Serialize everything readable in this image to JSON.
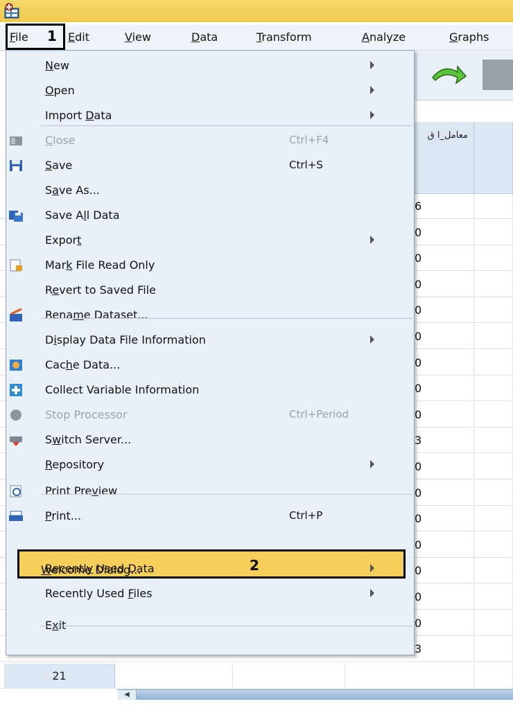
{
  "menubar": {
    "items": [
      {
        "pre": "",
        "u": "F",
        "post": "ile"
      },
      {
        "pre": "",
        "u": "E",
        "post": "dit"
      },
      {
        "pre": "",
        "u": "V",
        "post": "iew"
      },
      {
        "pre": "",
        "u": "D",
        "post": "ata"
      },
      {
        "pre": "",
        "u": "T",
        "post": "ransform"
      },
      {
        "pre": "",
        "u": "A",
        "post": "nalyze"
      },
      {
        "pre": "",
        "u": "G",
        "post": "raphs"
      }
    ],
    "callout_1": "1"
  },
  "grid": {
    "column_header": "معامل_ا ق",
    "fragments": [
      "6",
      "0",
      "0",
      "0",
      "0",
      "0",
      "0",
      "0",
      "0",
      "3",
      "0",
      "0",
      "0",
      "0",
      "0",
      "0",
      "0",
      "3"
    ],
    "row_label": "21"
  },
  "file_menu": {
    "items": [
      {
        "pre": "",
        "u": "N",
        "post": "ew",
        "shortcut": "",
        "submenu": true,
        "enabled": true
      },
      {
        "pre": "",
        "u": "O",
        "post": "pen",
        "shortcut": "",
        "submenu": true,
        "enabled": true
      },
      {
        "pre": "Import ",
        "u": "D",
        "post": "ata",
        "shortcut": "",
        "submenu": true,
        "enabled": true
      },
      {
        "pre": "",
        "u": "C",
        "post": "lose",
        "shortcut": "Ctrl+F4",
        "submenu": false,
        "enabled": false
      },
      {
        "pre": "",
        "u": "S",
        "post": "ave",
        "shortcut": "Ctrl+S",
        "submenu": false,
        "enabled": true
      },
      {
        "pre": "S",
        "u": "a",
        "post": "ve As...",
        "shortcut": "",
        "submenu": false,
        "enabled": true
      },
      {
        "pre": "Save A",
        "u": "l",
        "post": "l Data",
        "shortcut": "",
        "submenu": false,
        "enabled": true
      },
      {
        "pre": "Expor",
        "u": "t",
        "post": "",
        "shortcut": "",
        "submenu": true,
        "enabled": true
      },
      {
        "pre": "Mar",
        "u": "k",
        "post": " File Read Only",
        "shortcut": "",
        "submenu": false,
        "enabled": true
      },
      {
        "pre": "R",
        "u": "e",
        "post": "vert to Saved File",
        "shortcut": "",
        "submenu": false,
        "enabled": true
      },
      {
        "pre": "Rena",
        "u": "m",
        "post": "e Dataset...",
        "shortcut": "",
        "submenu": false,
        "enabled": true
      },
      {
        "pre": "D",
        "u": "i",
        "post": "splay Data File Information",
        "shortcut": "",
        "submenu": true,
        "enabled": true
      },
      {
        "pre": "Cac",
        "u": "h",
        "post": "e Data...",
        "shortcut": "",
        "submenu": false,
        "enabled": true
      },
      {
        "pre": "Collect Variable Information",
        "u": "",
        "post": "",
        "shortcut": "",
        "submenu": false,
        "enabled": true
      },
      {
        "pre": "Stop Processor",
        "u": "",
        "post": "",
        "shortcut": "Ctrl+Period",
        "submenu": false,
        "enabled": false
      },
      {
        "pre": "S",
        "u": "w",
        "post": "itch Server...",
        "shortcut": "",
        "submenu": false,
        "enabled": true
      },
      {
        "pre": "",
        "u": "R",
        "post": "epository",
        "shortcut": "",
        "submenu": true,
        "enabled": true
      },
      {
        "pre": "Print Pre",
        "u": "v",
        "post": "iew",
        "shortcut": "",
        "submenu": false,
        "enabled": true
      },
      {
        "pre": "",
        "u": "P",
        "post": "rint...",
        "shortcut": "Ctrl+P",
        "submenu": false,
        "enabled": true
      },
      {
        "pre": "",
        "u": "W",
        "post": "elcome Dialog...",
        "shortcut": "",
        "submenu": false,
        "enabled": true
      },
      {
        "pre": "Recentl",
        "u": "y",
        "post": " Used Data",
        "shortcut": "",
        "submenu": true,
        "enabled": true
      },
      {
        "pre": "Recently Used ",
        "u": "F",
        "post": "iles",
        "shortcut": "",
        "submenu": true,
        "enabled": true
      },
      {
        "pre": "E",
        "u": "x",
        "post": "it",
        "shortcut": "",
        "submenu": false,
        "enabled": true
      }
    ],
    "callout_2": "2"
  },
  "colors": {
    "highlight": "#f6cf5a",
    "title_bar": "#efc94c",
    "menu_bg": "#eaf0f8",
    "grid_header": "#dde7f3"
  }
}
